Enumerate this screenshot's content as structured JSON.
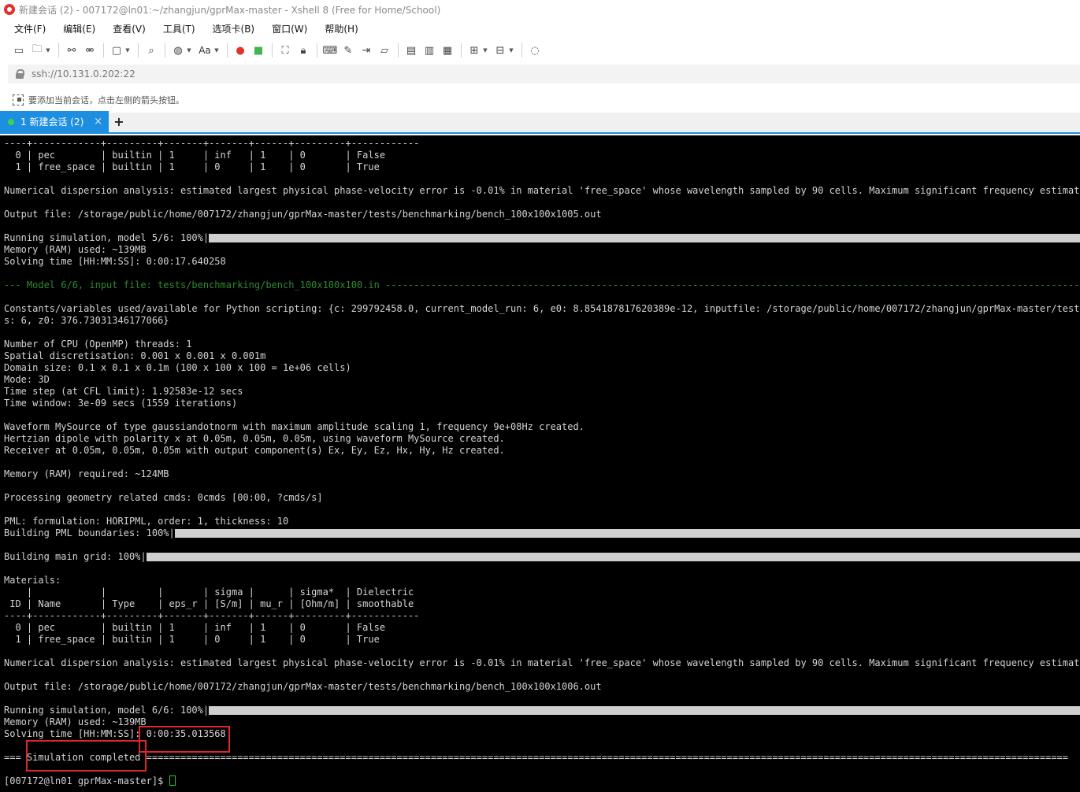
{
  "window": {
    "title": "新建会话 (2) - 007172@ln01:~/zhangjun/gprMax-master - Xshell 8 (Free for Home/School)"
  },
  "menu": {
    "items": [
      "文件(F)",
      "编辑(E)",
      "查看(V)",
      "工具(T)",
      "选项卡(B)",
      "窗口(W)",
      "帮助(H)"
    ]
  },
  "toolbar": {
    "font_label": "Aa"
  },
  "address": {
    "url": "ssh://10.131.0.202:22"
  },
  "hint": {
    "text": "要添加当前会话，点击左侧的箭头按钮。"
  },
  "tabs": [
    {
      "label": "1 新建会话 (2)",
      "close": "×"
    }
  ],
  "tab_add_label": "+",
  "terminal": {
    "lines": [
      {
        "text": "----+------------+---------+-------+-------+------+---------+------------"
      },
      {
        "text": "  0 | pec        | builtin | 1     | inf   | 1    | 0       | False"
      },
      {
        "text": "  1 | free_space | builtin | 1     | 0     | 1    | 0       | True"
      },
      {
        "text": ""
      },
      {
        "text": "Numerical dispersion analysis: estimated largest physical phase-velocity error is -0.01% in material 'free_space' whose wavelength sampled by 90 cells. Maximum significant frequency estimated as"
      },
      {
        "text": ""
      },
      {
        "text": "Output file: /storage/public/home/007172/zhangjun/gprMax-master/tests/benchmarking/bench_100x100x1005.out"
      },
      {
        "text": ""
      },
      {
        "text": "Running simulation, model 5/6: 100%|",
        "bar": 36
      },
      {
        "text": "Memory (RAM) used: ~139MB"
      },
      {
        "text": "Solving time [HH:MM:SS]: 0:00:17.640258"
      },
      {
        "text": ""
      },
      {
        "text": "--- Model 6/6, input file: tests/benchmarking/bench_100x100x100.in --------------------------------------------------------------------------------------------------------------------------------",
        "green": true
      },
      {
        "text": ""
      },
      {
        "text": "Constants/variables used/available for Python scripting: {c: 299792458.0, current_model_run: 6, e0: 8.854187817620389e-12, inputfile: /storage/public/home/007172/zhangjun/gprMax-master/tests/bench"
      },
      {
        "text": "s: 6, z0: 376.73031346177066}"
      },
      {
        "text": ""
      },
      {
        "text": "Number of CPU (OpenMP) threads: 1"
      },
      {
        "text": "Spatial discretisation: 0.001 x 0.001 x 0.001m"
      },
      {
        "text": "Domain size: 0.1 x 0.1 x 0.1m (100 x 100 x 100 = 1e+06 cells)"
      },
      {
        "text": "Mode: 3D"
      },
      {
        "text": "Time step (at CFL limit): 1.92583e-12 secs"
      },
      {
        "text": "Time window: 3e-09 secs (1559 iterations)"
      },
      {
        "text": ""
      },
      {
        "text": "Waveform MySource of type gaussiandotnorm with maximum amplitude scaling 1, frequency 9e+08Hz created."
      },
      {
        "text": "Hertzian dipole with polarity x at 0.05m, 0.05m, 0.05m, using waveform MySource created."
      },
      {
        "text": "Receiver at 0.05m, 0.05m, 0.05m with output component(s) Ex, Ey, Ez, Hx, Hy, Hz created."
      },
      {
        "text": ""
      },
      {
        "text": "Memory (RAM) required: ~124MB"
      },
      {
        "text": ""
      },
      {
        "text": "Processing geometry related cmds: 0cmds [00:00, ?cmds/s]"
      },
      {
        "text": ""
      },
      {
        "text": "PML: formulation: HORIPML, order: 1, thickness: 10"
      },
      {
        "text": "Building PML boundaries: 100%|",
        "bar": 30
      },
      {
        "text": ""
      },
      {
        "text": "Building main grid: 100%|",
        "bar": 25
      },
      {
        "text": ""
      },
      {
        "text": "Materials:"
      },
      {
        "text": "    |            |         |       | sigma |      | sigma*  | Dielectric"
      },
      {
        "text": " ID | Name       | Type    | eps_r | [S/m] | mu_r | [Ohm/m] | smoothable"
      },
      {
        "text": "----+------------+---------+-------+-------+------+---------+------------"
      },
      {
        "text": "  0 | pec        | builtin | 1     | inf   | 1    | 0       | False"
      },
      {
        "text": "  1 | free_space | builtin | 1     | 0     | 1    | 0       | True"
      },
      {
        "text": ""
      },
      {
        "text": "Numerical dispersion analysis: estimated largest physical phase-velocity error is -0.01% in material 'free_space' whose wavelength sampled by 90 cells. Maximum significant frequency estimated as"
      },
      {
        "text": ""
      },
      {
        "text": "Output file: /storage/public/home/007172/zhangjun/gprMax-master/tests/benchmarking/bench_100x100x1006.out"
      },
      {
        "text": ""
      },
      {
        "text": "Running simulation, model 6/6: 100%|",
        "bar": 36
      },
      {
        "text": "Memory (RAM) used: ~139MB"
      },
      {
        "text": "Solving time [HH:MM:SS]: 0:00:35.013568"
      },
      {
        "text": ""
      },
      {
        "text": "=== Simulation completed =================================================================================================================================================================="
      },
      {
        "text": ""
      },
      {
        "text": "[007172@ln01 gprMax-master]$ ",
        "cursor": true
      }
    ]
  },
  "highlight_color": "#e0262c"
}
